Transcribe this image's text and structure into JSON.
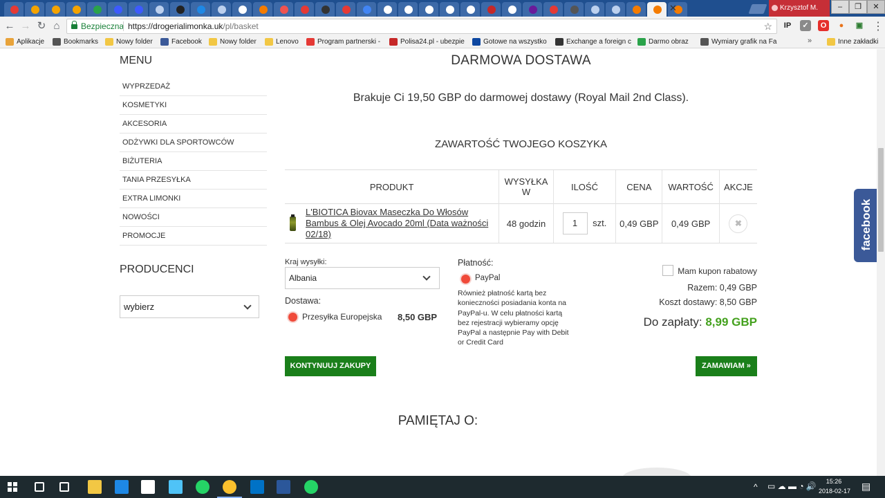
{
  "browser": {
    "profile_name": "Krzysztof M.",
    "secure_label": "Bezpieczna",
    "url_host": "https://drogerialimonka.uk",
    "url_path": "/pl/basket",
    "tab_favicon_colors": [
      "#e53935",
      "#f4a300",
      "#f4a300",
      "#f4a300",
      "#2aa34a",
      "#3d5afe",
      "#3d5afe",
      "#bcd0ee",
      "#222222",
      "#1e88e5",
      "#bcd0ee",
      "#ffffff",
      "#f57c00",
      "#ef5350",
      "#e53935",
      "#333333",
      "#e53935",
      "#4285f4",
      "#ffffff",
      "#ffffff",
      "#ffffff",
      "#ffffff",
      "#ffffff",
      "#c62828",
      "#ffffff",
      "#6a1b9a",
      "#e53935",
      "#555555",
      "#bcd0ee",
      "#bcd0ee",
      "#f57c00",
      "#f57c00",
      "#f57c00"
    ],
    "extensions": [
      {
        "icon": "ip-icon",
        "text": "IP",
        "color": "#222222",
        "bg": "transparent"
      },
      {
        "icon": "check-ext-icon",
        "text": "✓",
        "color": "#ffffff",
        "bg": "#8a8a8a"
      },
      {
        "icon": "opera-icon",
        "text": "O",
        "color": "#ffffff",
        "bg": "#e5302c"
      },
      {
        "icon": "fox-icon",
        "text": "●",
        "color": "#e8731a",
        "bg": "transparent"
      },
      {
        "icon": "cast-icon",
        "text": "▣",
        "color": "#2e7d32",
        "bg": "transparent"
      }
    ]
  },
  "bookmarks": [
    {
      "label": "Aplikacje",
      "icon": "apps-grid-icon",
      "color": "#e8a33a"
    },
    {
      "label": "Bookmarks",
      "icon": "star-icon",
      "color": "#555555"
    },
    {
      "label": "Nowy folder",
      "icon": "folder-icon",
      "color": "#f2c744"
    },
    {
      "label": "Facebook",
      "icon": "facebook-icon",
      "color": "#3b5998"
    },
    {
      "label": "Nowy folder",
      "icon": "folder-icon",
      "color": "#f2c744"
    },
    {
      "label": "Lenovo",
      "icon": "folder-icon",
      "color": "#f2c744"
    },
    {
      "label": "Program partnerski -",
      "icon": "u-icon",
      "color": "#e53935"
    },
    {
      "label": "Polisa24.pl - ubezpie",
      "icon": "polisa-icon",
      "color": "#c62828"
    },
    {
      "label": "Gotowe na wszystko",
      "icon": "play-icon",
      "color": "#0d47a1"
    },
    {
      "label": "Exchange a foreign c",
      "icon": "exchange-icon",
      "color": "#333333"
    },
    {
      "label": "Darmo obraz",
      "icon": "px-icon",
      "color": "#2aa34a"
    },
    {
      "label": "Wymiary grafik na Fa",
      "icon": "pen-icon",
      "color": "#555555"
    }
  ],
  "bookmarks_other": "Inne zakładki",
  "sidebar": {
    "menu_title": "MENU",
    "items": [
      "WYPRZEDAŻ",
      "KOSMETYKI",
      "AKCESORIA",
      "ODŻYWKI DLA SPORTOWCÓW",
      "BIŻUTERIA",
      "TANIA PRZESYŁKA",
      "EXTRA LIMONKI",
      "NOWOŚCI",
      "PROMOCJE"
    ],
    "producers_title": "PRODUCENCI",
    "producers_select": "wybierz"
  },
  "main": {
    "free_shipping_title": "DARMOWA DOSTAWA",
    "free_shipping_note": "Brakuje Ci 19,50 GBP do darmowej dostawy (Royal Mail 2nd Class).",
    "cart_title": "ZAWARTOŚĆ TWOJEGO KOSZYKA",
    "columns": [
      "PRODUKT",
      "WYSYŁKA W",
      "ILOŚĆ",
      "CENA",
      "WARTOŚĆ",
      "AKCJE"
    ],
    "item": {
      "name": "L'BIOTICA Biovax Maseczka Do Włosów Bambus & Olej Avocado 20ml (Data ważności 02/18)",
      "shipping_time": "48 godzin",
      "qty": "1",
      "unit": "szt.",
      "price": "0,49 GBP",
      "value": "0,49 GBP",
      "remove_icon": "✖"
    },
    "country_label": "Kraj wysyłki:",
    "country_value": "Albania",
    "delivery_label": "Dostawa:",
    "delivery_option": "Przesyłka Europejska",
    "delivery_price": "8,50 GBP",
    "payment_label": "Płatność:",
    "payment_option": "PayPal",
    "payment_note": "Również płatność kartą bez konieczności posiadania konta na PayPal-u. W celu płatności kartą bez rejestracji wybieramy opcję PayPal a następnie Pay with Debit or Credit Card",
    "coupon_label": "Mam kupon rabatowy",
    "subtotal": "Razem: 0,49 GBP",
    "shipping_cost": "Koszt dostawy: 8,50 GBP",
    "total_label": "Do zapłaty:",
    "total_value": "8,99 GBP",
    "continue_button": "KONTYNUUJ ZAKUPY",
    "order_button": "ZAMAWIAM »",
    "remember_title": "PAMIĘTAJ O:",
    "facebook_tab": "facebook",
    "accent_color": "#44a11e",
    "button_color": "#1a7f1a"
  },
  "taskbar": {
    "time": "15:26",
    "date": "2018-02-17",
    "apps": [
      {
        "icon": "search-icon",
        "color": "#ffffff"
      },
      {
        "icon": "task-view-icon",
        "color": "#ffffff"
      },
      {
        "icon": "file-explorer-icon",
        "color": "#f2c744"
      },
      {
        "icon": "edge-icon",
        "color": "#1e88e5"
      },
      {
        "icon": "store-icon",
        "color": "#ffffff"
      },
      {
        "icon": "remote-desktop-icon",
        "color": "#4fc3f7"
      },
      {
        "icon": "whatsapp-icon",
        "color": "#25d366"
      },
      {
        "icon": "chrome-icon",
        "color": "#fbc02d"
      },
      {
        "icon": "outlook-icon",
        "color": "#0072c6"
      },
      {
        "icon": "word-icon",
        "color": "#2b579a"
      },
      {
        "icon": "whatsapp-icon",
        "color": "#25d366"
      }
    ]
  }
}
